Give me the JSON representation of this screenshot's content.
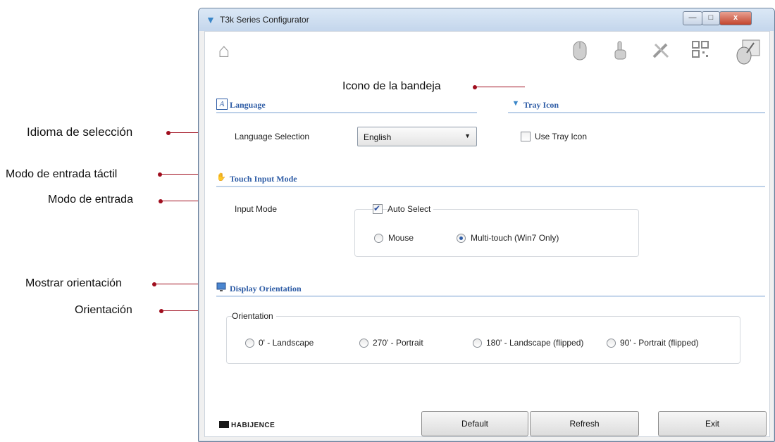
{
  "window": {
    "title": "T3k Series Configurator",
    "controls": {
      "minimize": "—",
      "maximize": "□",
      "close": "x"
    }
  },
  "toolbar": {
    "icons": [
      "home-icon",
      "mouse-icon",
      "touch-hand-icon",
      "tools-icon",
      "qr-code-icon",
      "settings-mouse-icon"
    ]
  },
  "language_section": {
    "title": "Language",
    "label": "Language Selection",
    "selected": "English"
  },
  "tray_section": {
    "title": "Tray Icon",
    "checkbox_label": "Use Tray Icon",
    "checked": false
  },
  "touch_section": {
    "title": "Touch Input Mode",
    "label": "Input Mode",
    "auto_select_label": "Auto Select",
    "auto_select_checked": true,
    "mouse_label": "Mouse",
    "multitouch_label": "Multi-touch (Win7 Only)",
    "selected": "multitouch"
  },
  "display_section": {
    "title": "Display Orientation",
    "group_label": "Orientation",
    "options": [
      "0' - Landscape",
      "270' - Portrait",
      "180' - Landscape (flipped)",
      "90' - Portrait (flipped)"
    ]
  },
  "footer": {
    "logo": "HABIJENCE",
    "default_label": "Default",
    "refresh_label": "Refresh",
    "exit_label": "Exit"
  },
  "callouts": {
    "tray": "Icono de la bandeja",
    "language": "Idioma de selección",
    "touch_mode": "Modo de entrada táctil",
    "input_mode": "Modo de entrada",
    "display": "Mostrar orientación",
    "orientation": "Orientación"
  },
  "colors": {
    "callout_accent": "#a00e1e",
    "section_title": "#2f5da6",
    "window_frame": "#6a7f99"
  }
}
